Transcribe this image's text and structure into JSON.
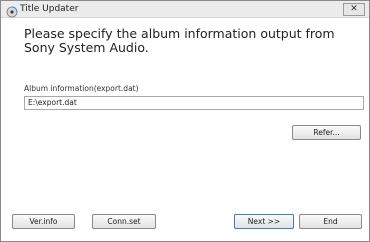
{
  "window": {
    "title": "Title Updater",
    "close_label": "✕"
  },
  "main": {
    "heading": "Please specify the album information output from Sony System Audio.",
    "album_info_label": "Album information(export.dat)",
    "album_info_value": "E:\\export.dat",
    "refer_button": "Refer..."
  },
  "footer": {
    "verinfo_button": "Ver.info",
    "connset_button": "Conn.set",
    "next_button": "Next >>",
    "end_button": "End"
  }
}
